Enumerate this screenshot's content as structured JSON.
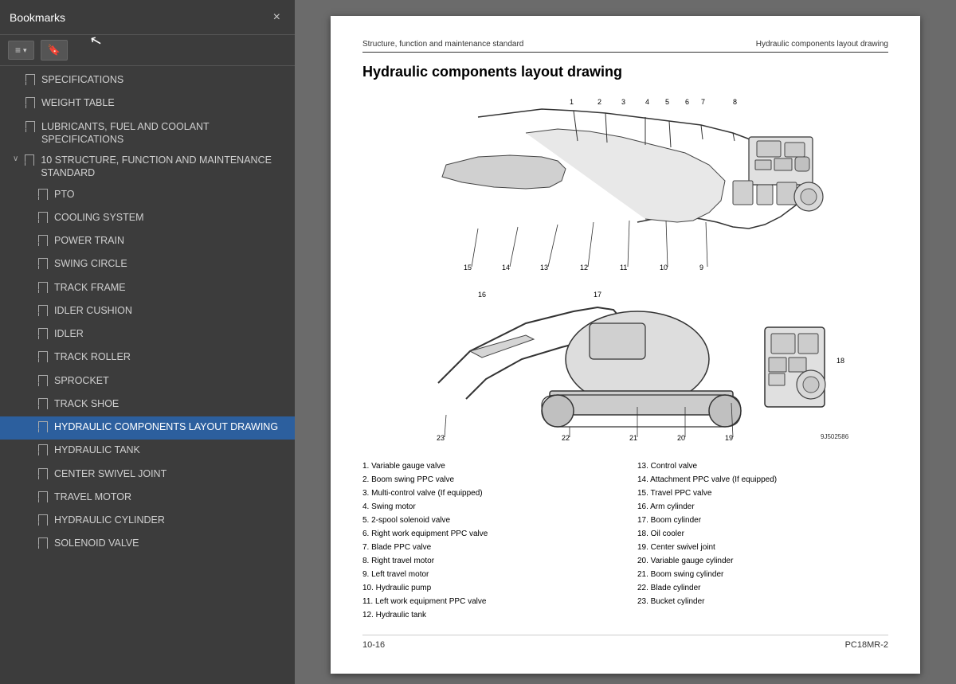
{
  "sidebar": {
    "title": "Bookmarks",
    "close_label": "×",
    "toolbar": {
      "view_btn": "≡ ▾",
      "bookmark_btn": "🔖"
    },
    "items": [
      {
        "id": "specifications",
        "label": "SPECIFICATIONS",
        "level": 2,
        "active": false
      },
      {
        "id": "weight-table",
        "label": "WEIGHT TABLE",
        "level": 2,
        "active": false
      },
      {
        "id": "lubricants",
        "label": "LUBRICANTS, FUEL AND COOLANT SPECIFICATIONS",
        "level": 2,
        "active": false
      },
      {
        "id": "structure",
        "label": "10 STRUCTURE, FUNCTION AND MAINTENANCE STANDARD",
        "level": 1,
        "active": false,
        "expanded": true
      },
      {
        "id": "pto",
        "label": "PTO",
        "level": 3,
        "active": false
      },
      {
        "id": "cooling-system",
        "label": "COOLING SYSTEM",
        "level": 3,
        "active": false
      },
      {
        "id": "power-train",
        "label": "POWER TRAIN",
        "level": 3,
        "active": false
      },
      {
        "id": "swing-circle",
        "label": "SWING CIRCLE",
        "level": 3,
        "active": false
      },
      {
        "id": "track-frame",
        "label": "TRACK FRAME",
        "level": 3,
        "active": false
      },
      {
        "id": "idler-cushion",
        "label": "IDLER CUSHION",
        "level": 3,
        "active": false
      },
      {
        "id": "idler",
        "label": "IDLER",
        "level": 3,
        "active": false
      },
      {
        "id": "track-roller",
        "label": "TRACK ROLLER",
        "level": 3,
        "active": false
      },
      {
        "id": "sprocket",
        "label": "SPROCKET",
        "level": 3,
        "active": false
      },
      {
        "id": "track-shoe",
        "label": "TRACK SHOE",
        "level": 3,
        "active": false
      },
      {
        "id": "hydraulic-components",
        "label": "HYDRAULIC COMPONENTS LAYOUT DRAWING",
        "level": 3,
        "active": true
      },
      {
        "id": "hydraulic-tank",
        "label": "HYDRAULIC TANK",
        "level": 3,
        "active": false
      },
      {
        "id": "center-swivel-joint",
        "label": "CENTER SWIVEL JOINT",
        "level": 3,
        "active": false
      },
      {
        "id": "travel-motor",
        "label": "TRAVEL MOTOR",
        "level": 3,
        "active": false
      },
      {
        "id": "hydraulic-cylinder",
        "label": "HYDRAULIC CYLINDER",
        "level": 3,
        "active": false
      },
      {
        "id": "solenoid-valve",
        "label": "SOLENOID VALVE",
        "level": 3,
        "active": false
      }
    ]
  },
  "page": {
    "header_left": "Structure, function and maintenance standard",
    "header_right": "Hydraulic components layout drawing",
    "title": "Hydraulic components layout drawing",
    "footer_left": "10-16",
    "footer_right": "PC18MR-2",
    "diagram_ref": "9J502586",
    "legend": [
      {
        "num": "1",
        "text": "Variable gauge valve"
      },
      {
        "num": "2",
        "text": "Boom swing PPC valve"
      },
      {
        "num": "3",
        "text": "Multi-control valve (If equipped)"
      },
      {
        "num": "4",
        "text": "Swing motor"
      },
      {
        "num": "5",
        "text": "2-spool solenoid valve"
      },
      {
        "num": "6",
        "text": "Right work equipment PPC valve"
      },
      {
        "num": "7",
        "text": "Blade PPC valve"
      },
      {
        "num": "8",
        "text": "Right travel motor"
      },
      {
        "num": "9",
        "text": "Left travel motor"
      },
      {
        "num": "10",
        "text": "Hydraulic pump"
      },
      {
        "num": "11",
        "text": "Left work equipment PPC valve"
      },
      {
        "num": "12",
        "text": "Hydraulic tank"
      },
      {
        "num": "13",
        "text": "Control valve"
      },
      {
        "num": "14",
        "text": "Attachment PPC valve (If equipped)"
      },
      {
        "num": "15",
        "text": "Travel PPC valve"
      },
      {
        "num": "16",
        "text": "Arm cylinder"
      },
      {
        "num": "17",
        "text": "Boom cylinder"
      },
      {
        "num": "18",
        "text": "Oil cooler"
      },
      {
        "num": "19",
        "text": "Center swivel joint"
      },
      {
        "num": "20",
        "text": "Variable gauge cylinder"
      },
      {
        "num": "21",
        "text": "Boom swing cylinder"
      },
      {
        "num": "22",
        "text": "Blade cylinder"
      },
      {
        "num": "23",
        "text": "Bucket cylinder"
      }
    ]
  }
}
